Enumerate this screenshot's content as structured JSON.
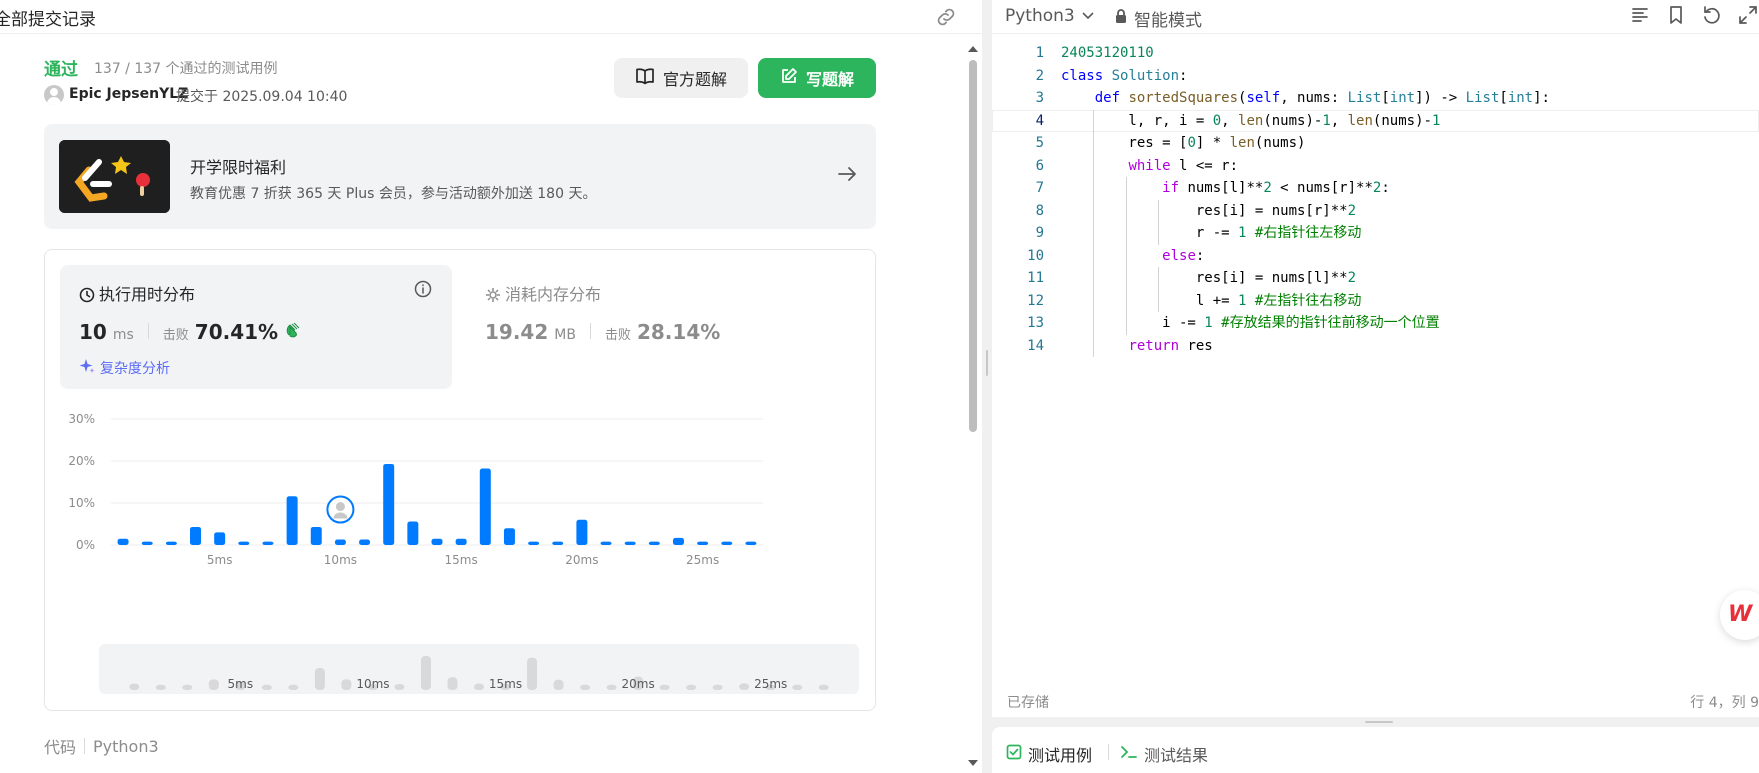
{
  "left": {
    "title": "全部提交记录",
    "status": "通过",
    "passed_cases": "137 / 137 个通过的测试用例",
    "user": "Epic JepsenYLZ",
    "submitted_at": "提交于 2025.09.04 10:40",
    "official_solution_btn": "官方题解",
    "write_solution_btn": "写题解",
    "promo": {
      "title": "开学限时福利",
      "desc": "教育优惠 7 折获 365 天 Plus 会员，参与活动额外加送 180 天。"
    },
    "runtime": {
      "title": "执行用时分布",
      "value": "10",
      "unit": "ms",
      "beat_label": "击败",
      "beat": "70.41%",
      "complexity_link": "复杂度分析"
    },
    "memory": {
      "title": "消耗内存分布",
      "value": "19.42",
      "unit": "MB",
      "beat_label": "击败",
      "beat": "28.14%"
    },
    "code_label": "代码",
    "code_lang": "Python3"
  },
  "chart_data": {
    "type": "bar",
    "x": [
      1,
      2,
      3,
      4,
      5,
      6,
      7,
      8,
      9,
      10,
      11,
      12,
      13,
      14,
      15,
      16,
      17,
      18,
      19,
      20,
      21,
      22,
      23,
      24,
      25,
      26,
      27
    ],
    "values": [
      1.5,
      0.8,
      0.8,
      4.3,
      3.0,
      0.8,
      0.8,
      11.6,
      4.3,
      1.3,
      1.3,
      19.3,
      5.6,
      1.5,
      1.5,
      18.2,
      4.0,
      0.8,
      0.8,
      6.0,
      0.8,
      0.8,
      0.8,
      1.7,
      0.8,
      0.8,
      0.8
    ],
    "ylim": [
      0,
      30
    ],
    "yticks": [
      "0%",
      "10%",
      "20%",
      "30%"
    ],
    "xticks": [
      "5ms",
      "10ms",
      "15ms",
      "20ms",
      "25ms"
    ],
    "xtick_values": [
      5,
      10,
      15,
      20,
      25
    ],
    "highlight_x": 10,
    "bar_color": "#007aff",
    "grid": true
  },
  "editor": {
    "language": "Python3",
    "mode": "智能模式",
    "saved": "已存储",
    "cursor": "行 4，列 9",
    "lines": [
      "24053120110",
      "class Solution:",
      "    def sortedSquares(self, nums: List[int]) -> List[int]:",
      "        l, r, i = 0, len(nums)-1, len(nums)-1",
      "        res = [0] * len(nums)",
      "        while l <= r:",
      "            if nums[l]**2 < nums[r]**2:",
      "                res[i] = nums[r]**2",
      "                r -= 1 #右指针往左移动",
      "            else:",
      "                res[i] = nums[l]**2",
      "                l += 1 #左指针往右移动",
      "            i -= 1 #存放结果的指针往前移动一个位置",
      "        return res"
    ]
  },
  "bottom_tabs": {
    "test_cases": "测试用例",
    "test_result": "测试结果"
  },
  "colors": {
    "accent_green": "#2db55d",
    "bar_blue": "#007aff",
    "link_purple": "#5c6cf5"
  }
}
